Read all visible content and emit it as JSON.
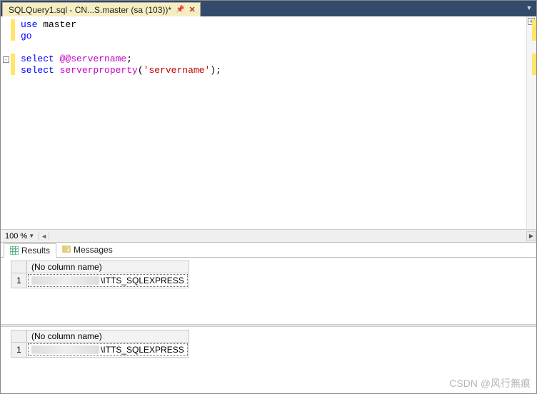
{
  "tab": {
    "title": "SQLQuery1.sql - CN...S.master (sa (103))*"
  },
  "editor": {
    "lines": {
      "l1_kw_use": "use",
      "l1_db": " master",
      "l2_kw_go": "go",
      "l4_kw_select": "select",
      "l4_sys": " @@servername",
      "l4_term": ";",
      "l5_kw_select": "select",
      "l5_fn": " serverproperty",
      "l5_open": "(",
      "l5_str": "'servername'",
      "l5_close": ");"
    }
  },
  "zoom": {
    "value": "100 %"
  },
  "results_tabs": {
    "results": "Results",
    "messages": "Messages"
  },
  "results": {
    "grid1": {
      "header": "(No column name)",
      "rownum": "1",
      "value_suffix": "\\ITTS_SQLEXPRESS"
    },
    "grid2": {
      "header": "(No column name)",
      "rownum": "1",
      "value_suffix": "\\ITTS_SQLEXPRESS"
    }
  },
  "watermark": "CSDN @风行無痕"
}
